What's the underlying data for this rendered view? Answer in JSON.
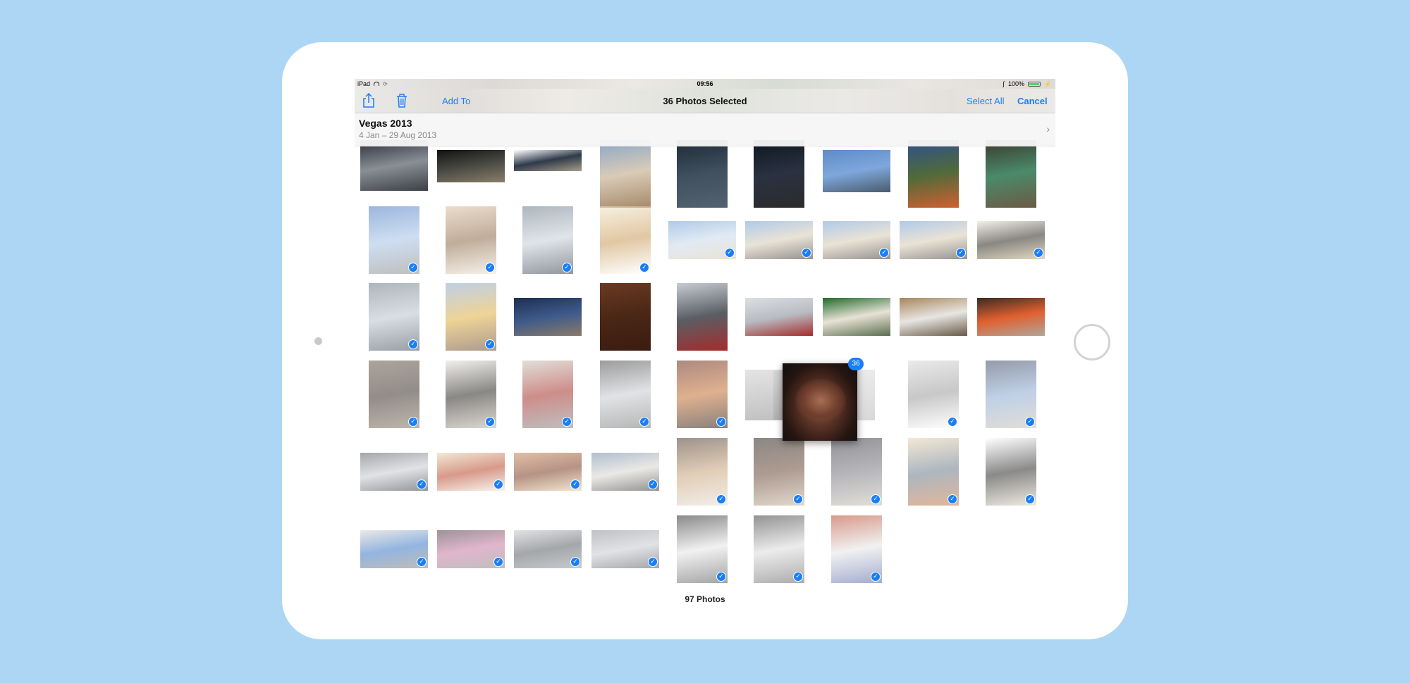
{
  "status_bar": {
    "device": "iPad",
    "time": "09:56",
    "battery": "100%"
  },
  "nav_bar": {
    "add_to": "Add To",
    "title": "36 Photos Selected",
    "select_all": "Select All",
    "cancel": "Cancel"
  },
  "album": {
    "title": "Vegas 2013",
    "dates": "4 Jan – 29 Aug 2013"
  },
  "drag": {
    "badge_count": "36"
  },
  "footer": {
    "count": "97 Photos"
  },
  "colors": {
    "accent": "#1a7ff6",
    "background": "#add6f5"
  },
  "photos": [
    {
      "c": [
        "#2a2f3a",
        "#8a8f96",
        "#3c3f45"
      ],
      "sel": false
    },
    {
      "c": [
        "#111",
        "#4a4a44",
        "#8b7e6a"
      ],
      "sel": false
    },
    {
      "c": [
        "#ffffff",
        "#2e3a4a",
        "#a89a8a"
      ],
      "sel": false
    },
    {
      "c": [
        "#8aa6c8",
        "#d9cbb7",
        "#a7896a"
      ],
      "sel": false
    },
    {
      "c": [
        "#1e2a38",
        "#40505e",
        "#546270"
      ],
      "sel": false
    },
    {
      "c": [
        "#0e1522",
        "#2a3140",
        "#2b2b2b"
      ],
      "sel": false
    },
    {
      "c": [
        "#5e8cc8",
        "#7ea7dc",
        "#4b5b6c"
      ],
      "sel": false
    },
    {
      "c": [
        "#2e4f8f",
        "#506a3a",
        "#d06030"
      ],
      "sel": false
    },
    {
      "c": [
        "#3a3a2c",
        "#4a8a6a",
        "#6c5a44"
      ],
      "sel": false
    },
    {
      "c": [
        "#4a7ac0",
        "#a6c3e6",
        "#8a8a8a"
      ],
      "sel": true
    },
    {
      "c": [
        "#d9c3a2",
        "#8c6a48",
        "#efe6d6"
      ],
      "sel": true
    },
    {
      "c": [
        "#6a7a8a",
        "#c7cfd6",
        "#3a4050"
      ],
      "sel": true
    },
    {
      "c": [
        "#f0e4c6",
        "#c99a58",
        "#ffffff"
      ],
      "sel": true
    },
    {
      "c": [
        "#6e9fd6",
        "#c9d9ea",
        "#d8cbb4"
      ],
      "sel": true
    },
    {
      "c": [
        "#6e9fd6",
        "#d8cbb4",
        "#3e3a36"
      ],
      "sel": true
    },
    {
      "c": [
        "#6e9fd6",
        "#d8cbb4",
        "#3e3a36"
      ],
      "sel": true
    },
    {
      "c": [
        "#6e9fd6",
        "#d8cbb4",
        "#3e3a36"
      ],
      "sel": true
    },
    {
      "c": [
        "#e8e2d6",
        "#2a2620",
        "#c9b98a"
      ],
      "sel": true
    },
    {
      "c": [
        "#6a7a86",
        "#b9c3cc",
        "#45505a"
      ],
      "sel": true
    },
    {
      "c": [
        "#8aa8d2",
        "#e0b040",
        "#6a4a34"
      ],
      "sel": true
    },
    {
      "c": [
        "#1c2e52",
        "#3e5a8a",
        "#8a7a6a"
      ],
      "sel": false
    },
    {
      "c": [
        "#6a3a22",
        "#4a2616",
        "#3a1c10"
      ],
      "sel": false
    },
    {
      "c": [
        "#c6ccd2",
        "#5a5e64",
        "#a42c2c"
      ],
      "sel": false
    },
    {
      "c": [
        "#dcdfe2",
        "#b8bcc2",
        "#a42c2c"
      ],
      "sel": false
    },
    {
      "c": [
        "#1f6a2a",
        "#e8e2d6",
        "#5a6e50"
      ],
      "sel": false
    },
    {
      "c": [
        "#a6865c",
        "#e8e6e2",
        "#6a5a48"
      ],
      "sel": false
    },
    {
      "c": [
        "#3a2a22",
        "#e06030",
        "#b0a69a"
      ],
      "sel": false
    },
    {
      "c": [
        "#6a5a48",
        "#3a302a",
        "#8a7a66"
      ],
      "sel": true
    },
    {
      "c": [
        "#e6e2dc",
        "#2a2622",
        "#bdb7ae"
      ],
      "sel": true
    },
    {
      "c": [
        "#c9c3b8",
        "#a6302a",
        "#8a8a8a"
      ],
      "sel": true
    },
    {
      "c": [
        "#4a4a4a",
        "#c7cbd0",
        "#7a7a7a"
      ],
      "sel": true
    },
    {
      "c": [
        "#6a2a18",
        "#c47034",
        "#2a1a12"
      ],
      "sel": true
    },
    {
      "c": [
        "#d8d8d8",
        "#9a9a9a",
        "#ffffff"
      ],
      "sel": true
    },
    {
      "c": [
        "#3e4a62",
        "#8aa8d2",
        "#c9c3b8"
      ],
      "sel": true
    },
    {
      "c": [
        "#5a5e64",
        "#c7cbd0",
        "#3a3e44"
      ],
      "sel": true
    },
    {
      "c": [
        "#e8d6b2",
        "#b8462a",
        "#f0eae0"
      ],
      "sel": true
    },
    {
      "c": [
        "#c98a5a",
        "#7a3a22",
        "#e6cfa8"
      ],
      "sel": true
    },
    {
      "c": [
        "#6e8aa8",
        "#d9d6d0",
        "#3a3a3a"
      ],
      "sel": true
    },
    {
      "c": [
        "#4a3a2e",
        "#c9a27a",
        "#e6e0d6"
      ],
      "sel": true
    },
    {
      "c": [
        "#2e2420",
        "#6a4a36",
        "#c9b6a0"
      ],
      "sel": true
    },
    {
      "c": [
        "#3a3a42",
        "#7a7a82",
        "#c9c3b8"
      ],
      "sel": true
    },
    {
      "c": [
        "#e8d6b2",
        "#6a7a8a",
        "#c97a48"
      ],
      "sel": true
    },
    {
      "c": [
        "#ffffff",
        "#2a2a2a",
        "#e0d8c8"
      ],
      "sel": true
    },
    {
      "c": [
        "#d9d6d0",
        "#3a78c8",
        "#8a8680"
      ],
      "sel": true
    },
    {
      "c": [
        "#4a3a44",
        "#c97aa2",
        "#8a8a8a"
      ],
      "sel": true
    },
    {
      "c": [
        "#c7cbd0",
        "#5a5e64",
        "#9aa0a6"
      ],
      "sel": true
    },
    {
      "c": [
        "#8a8e94",
        "#c7cbd0",
        "#5a5e64"
      ],
      "sel": true
    },
    {
      "c": [
        "#2a2a2a",
        "#e6e6e6",
        "#5a5a5a"
      ],
      "sel": true
    },
    {
      "c": [
        "#3a3a3a",
        "#dcdcdc",
        "#6a6a6a"
      ],
      "sel": true
    },
    {
      "c": [
        "#b8462a",
        "#e6e6e6",
        "#5a6aa8"
      ],
      "sel": true
    },
    {
      "c": [
        "#6a3a22",
        "#c98a5a",
        "#3a2016"
      ],
      "sel": true
    }
  ]
}
